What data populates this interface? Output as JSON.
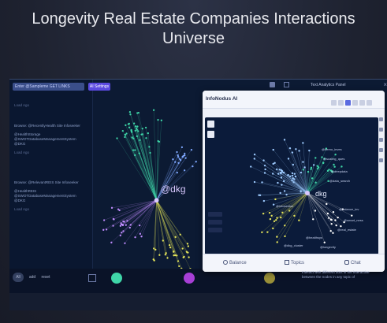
{
  "page": {
    "title": "Longevity Real Estate Companies Interactions Universe"
  },
  "app": {
    "search_placeholder": "Enter @Sampleme GET LINKS",
    "system_button": "AI Settings",
    "right_panel_title": "Text Analytics Panel",
    "left_messages": [
      {
        "label": "Load Ago"
      },
      {
        "text": "Browse: @RecentlyHealth Site Infoseeker",
        "sub": "@HealthStorage @SWOTDatabaseManagementSystem @DKG",
        "label": "Load Ago"
      },
      {
        "text": "Browse: @RelevantREIS Site Infoseeker",
        "sub": "@HealthREIS @SWOTDatabaseManagementSystem @DKG",
        "label": "Load Ago"
      }
    ],
    "hub_label": "@dkg",
    "bottom_controls": [
      "All",
      "add",
      "reset"
    ],
    "right_bottom_text": "Interact with different dots in the interactive between the nodes in any topic of"
  },
  "modal": {
    "title": "InfoNodus AI",
    "footer_buttons": [
      {
        "icon": "bulb-icon",
        "label": "Balance"
      },
      {
        "icon": "book-icon",
        "label": "Topics"
      },
      {
        "icon": "chat-icon",
        "label": "Chat"
      }
    ],
    "graph_hub_label": "dkg",
    "graph_labels": [
      "@dkg",
      "@demo_inves",
      "@scaling_ques",
      "@deepdata",
      "@data_search",
      "@balance_inv",
      "@smart_ness",
      "@real_estate",
      "@healthsys",
      "@dkg_cluster",
      "@longevity",
      "@infoseeker"
    ]
  },
  "colors": {
    "background": "#1f2433",
    "app_background": "#0c1a33",
    "modal_background": "#eef1f8",
    "accent_purple": "#5b4ae0",
    "cluster_green": "#3fd6a8",
    "cluster_violet": "#c08cff",
    "cluster_yellow": "#e6e65a"
  }
}
